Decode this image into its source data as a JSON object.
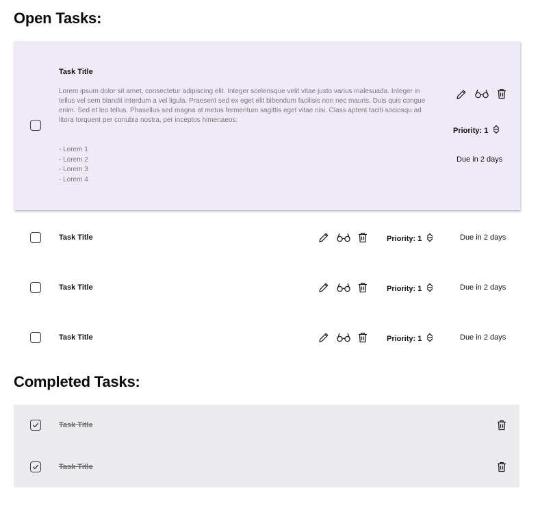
{
  "open_section": {
    "title": "Open Tasks:"
  },
  "completed_section": {
    "title": "Completed Tasks:"
  },
  "expanded_task": {
    "title": "Task Title",
    "description": "Lorem ipsum dolor sit amet, consectetur adipiscing elit. Integer scelerisque velit vitae justo varius malesuada. Integer in tellus vel sem blandit interdum a vel ligula. Praesent sed ex eget elit bibendum facilisis non nec mauris. Duis quis congue enim. Sed et leo tellus. Phasellus sed magna at metus fermentum sagittis eget vitae nisi. Class aptent taciti sociosqu ad litora torquent per conubia nostra, per inceptos himenaeos:",
    "list_items": [
      "- Lorem 1",
      "- Lorem 2",
      "- Lorem 3",
      "- Lorem 4"
    ],
    "priority_label": "Priority: 1",
    "due": "Due in 2 days",
    "checked": false
  },
  "open_tasks": [
    {
      "title": "Task Title",
      "priority_label": "Priority: 1",
      "due": "Due in 2 days",
      "checked": false
    },
    {
      "title": "Task Title",
      "priority_label": "Priority: 1",
      "due": "Due in 2 days",
      "checked": false
    },
    {
      "title": "Task Title",
      "priority_label": "Priority: 1",
      "due": "Due in 2 days",
      "checked": false
    }
  ],
  "completed_tasks": [
    {
      "title": "Task Title",
      "checked": true
    },
    {
      "title": "Task Title",
      "checked": true
    }
  ],
  "icons": {
    "edit": "pencil-icon",
    "view": "glasses-icon",
    "delete": "trash-icon",
    "priority_sort": "sort-arrows-icon",
    "check": "checkmark-icon"
  },
  "colors": {
    "expanded_card_bg": "#efeaf7",
    "completed_panel_bg": "#ececee",
    "muted_text": "#7a7a7a"
  }
}
